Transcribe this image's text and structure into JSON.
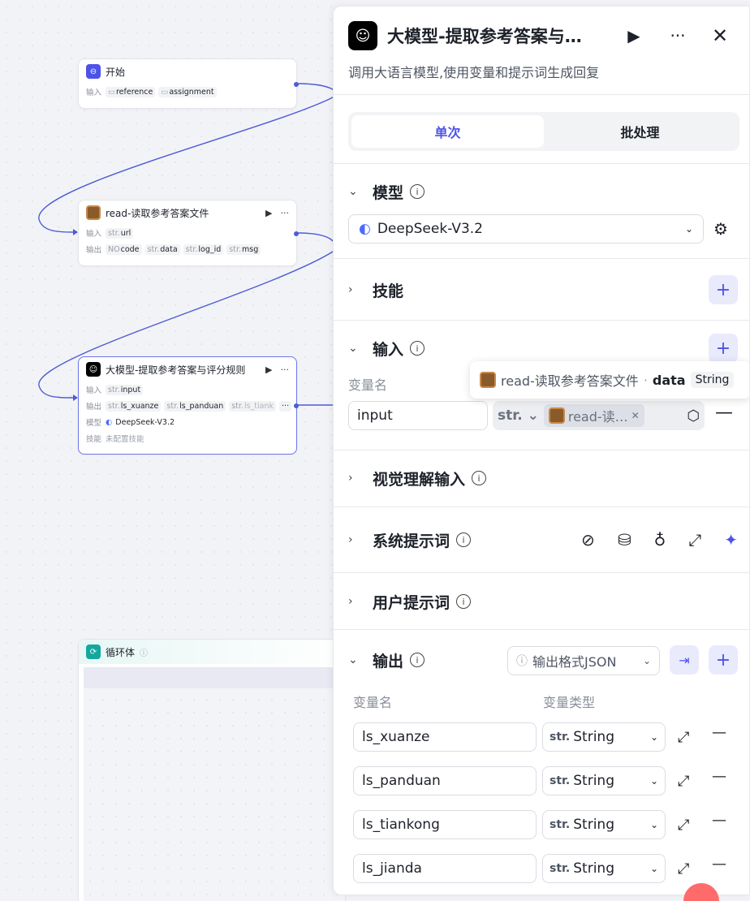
{
  "canvas": {
    "start_node": {
      "title": "开始",
      "inputs_label": "输入",
      "inputs": [
        "reference",
        "assignment"
      ]
    },
    "read_node": {
      "title": "read-读取参考答案文件",
      "inputs_label": "输入",
      "inputs": [
        {
          "type": "str.",
          "name": "url"
        }
      ],
      "outputs_label": "输出",
      "outputs": [
        {
          "type": "NO",
          "name": "code"
        },
        {
          "type": "str.",
          "name": "data"
        },
        {
          "type": "str.",
          "name": "log_id"
        },
        {
          "type": "str.",
          "name": "msg"
        }
      ]
    },
    "llm_node": {
      "title": "大模型-提取参考答案与评分规则",
      "inputs_label": "输入",
      "inputs": [
        {
          "type": "str.",
          "name": "input"
        }
      ],
      "outputs_label": "输出",
      "outputs": [
        {
          "type": "str.",
          "name": "ls_xuanze"
        },
        {
          "type": "str.",
          "name": "ls_panduan"
        },
        {
          "type": "str.",
          "name": "ls_tiank"
        }
      ],
      "more": "···",
      "model_label": "模型",
      "model_value": "DeepSeek-V3.2",
      "skill_label": "技能",
      "skill_value": "未配置技能"
    },
    "loop_node": {
      "title": "循环体"
    }
  },
  "panel": {
    "title": "大模型-提取参考答案与…",
    "description": "调用大语言模型,使用变量和提示词生成回复",
    "tabs": [
      {
        "label": "单次",
        "active": true
      },
      {
        "label": "批处理",
        "active": false
      }
    ],
    "model_section": {
      "title": "模型",
      "selected_model": "DeepSeek-V3.2"
    },
    "skill_section": {
      "title": "技能"
    },
    "input_section": {
      "title": "输入",
      "var_name_label": "变量名",
      "var_name": "input",
      "var_type": "str.",
      "ref_chip": "read-读…",
      "tooltip": {
        "source": "read-读取参考答案文件",
        "separator": "·",
        "field": "data",
        "type": "String"
      }
    },
    "vision_section": {
      "title": "视觉理解输入"
    },
    "system_prompt_section": {
      "title": "系统提示词"
    },
    "user_prompt_section": {
      "title": "用户提示词"
    },
    "output_section": {
      "title": "输出",
      "format": "输出格式JSON",
      "col_name": "变量名",
      "col_type": "变量类型",
      "rows": [
        {
          "name": "ls_xuanze",
          "type_prefix": "str.",
          "type": "String"
        },
        {
          "name": "ls_panduan",
          "type_prefix": "str.",
          "type": "String"
        },
        {
          "name": "ls_tiankong",
          "type_prefix": "str.",
          "type": "String"
        },
        {
          "name": "ls_jianda",
          "type_prefix": "str.",
          "type": "String"
        }
      ]
    }
  },
  "colors": {
    "accent": "#4d53e8",
    "edge": "#4d5bd6",
    "loop": "#13a89e"
  }
}
